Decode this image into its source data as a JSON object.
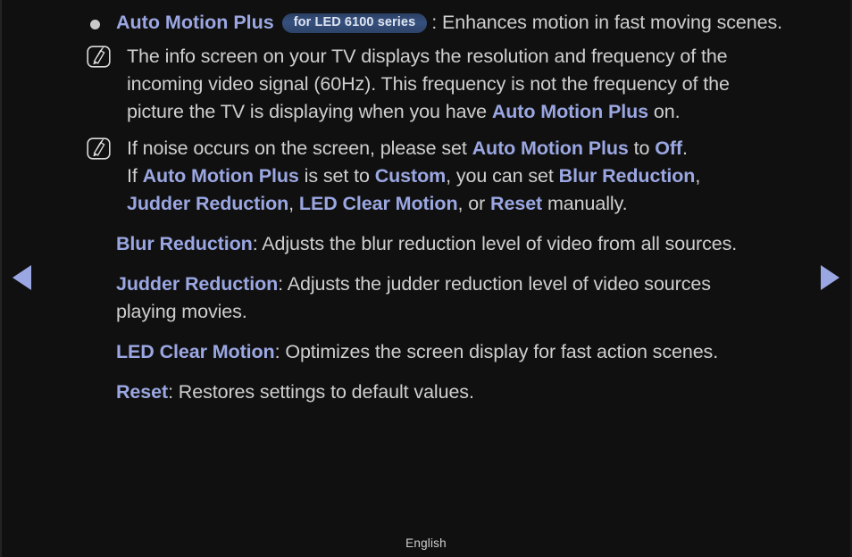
{
  "page": {
    "background_color": "#111010",
    "accent_color": "#9aa7e2",
    "body_text_color": "#cfcfcf",
    "badge_color": "#36517f"
  },
  "heading": {
    "term": "Auto Motion Plus",
    "badge": "for LED 6100 series",
    "description": ": Enhances motion in fast moving scenes."
  },
  "notes": [
    {
      "icon": "note-icon",
      "line1": "The info screen on your TV displays the resolution and frequency of the",
      "line2": "incoming video signal (60Hz). This frequency is not the frequency of the",
      "line3_a": "picture the TV is displaying when you have ",
      "line3_term": "Auto Motion Plus",
      "line3_b": " on."
    },
    {
      "icon": "note-icon",
      "line1_a": "If noise occurs on the screen, please set ",
      "line1_term1": "Auto Motion Plus",
      "line1_b": " to ",
      "line1_term2": "Off",
      "line1_c": ".",
      "line2_a": "If ",
      "line2_term1": "Auto Motion Plus",
      "line2_b": " is set to ",
      "line2_term2": "Custom",
      "line2_c": ", you can set ",
      "line2_term3": "Blur Reduction",
      "line2_d": ",",
      "line3_term1": "Judder Reduction",
      "line3_a": ", ",
      "line3_term2": "LED Clear Motion",
      "line3_b": ", or ",
      "line3_term3": "Reset",
      "line3_c": " manually."
    }
  ],
  "definitions": [
    {
      "term": "Blur Reduction",
      "line1": ": Adjusts the blur reduction level of video from all sources."
    },
    {
      "term": "Judder Reduction",
      "line1": ": Adjusts the judder reduction level of video sources",
      "line2": "playing movies."
    },
    {
      "term": "LED Clear Motion",
      "line1": ": Optimizes the screen display for fast action scenes."
    },
    {
      "term": "Reset",
      "line1": ": Restores settings to default values."
    }
  ],
  "nav": {
    "previous_label": "Previous page",
    "next_label": "Next page"
  },
  "footer": {
    "language": "English"
  }
}
